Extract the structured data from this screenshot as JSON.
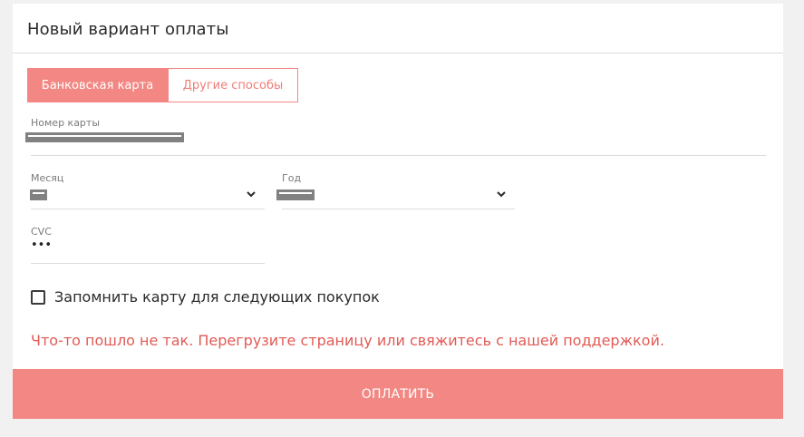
{
  "form": {
    "title": "Новый вариант оплаты",
    "tabs": [
      {
        "label": "Банковская карта",
        "active": true
      },
      {
        "label": "Другие способы",
        "active": false
      }
    ],
    "fields": {
      "card_number": {
        "label": "Номер карты"
      },
      "month": {
        "label": "Месяц"
      },
      "year": {
        "label": "Год"
      },
      "cvc": {
        "label": "CVC",
        "value": "•••"
      }
    },
    "remember_card_label": "Запомнить карту для следующих покупок",
    "remember_card_checked": false,
    "error_message": "Что-то пошло не так. Перегрузите страницу или свяжитесь с нашей поддержкой.",
    "pay_button_label": "ОПЛАТИТЬ"
  },
  "colors": {
    "accent": "#f28783",
    "error": "#e15a55",
    "background": "#f1f1f1",
    "card": "#ffffff"
  }
}
